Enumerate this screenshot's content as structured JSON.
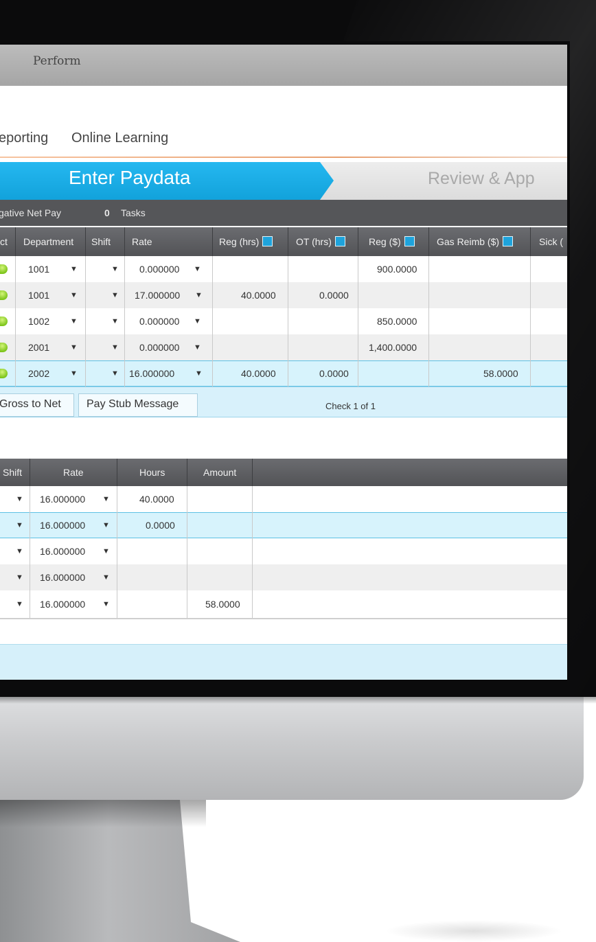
{
  "app": {
    "title": "Perform"
  },
  "menu": {
    "items": [
      "eporting",
      "Online Learning"
    ]
  },
  "steps": {
    "active": "Enter Paydata",
    "next": "Review & App"
  },
  "summary": {
    "label": "gative Net Pay",
    "task_count": "0",
    "task_label": "Tasks"
  },
  "top_grid": {
    "headers": {
      "select": "ct",
      "department": "Department",
      "shift": "Shift",
      "rate": "Rate",
      "reg_hrs": "Reg (hrs)",
      "ot_hrs": "OT (hrs)",
      "reg_dollars": "Reg ($)",
      "gas_reimb": "Gas Reimb ($)",
      "sick": "Sick ("
    },
    "rows": [
      {
        "department": "1001",
        "rate": "0.000000",
        "reg_hrs": "",
        "ot_hrs": "",
        "reg_dollars": "900.0000",
        "gas_reimb": ""
      },
      {
        "department": "1001",
        "rate": "17.000000",
        "reg_hrs": "40.0000",
        "ot_hrs": "0.0000",
        "reg_dollars": "",
        "gas_reimb": ""
      },
      {
        "department": "1002",
        "rate": "0.000000",
        "reg_hrs": "",
        "ot_hrs": "",
        "reg_dollars": "850.0000",
        "gas_reimb": ""
      },
      {
        "department": "2001",
        "rate": "0.000000",
        "reg_hrs": "",
        "ot_hrs": "",
        "reg_dollars": "1,400.0000",
        "gas_reimb": ""
      },
      {
        "department": "2002",
        "rate": "16.000000",
        "reg_hrs": "40.0000",
        "ot_hrs": "0.0000",
        "reg_dollars": "",
        "gas_reimb": "58.0000"
      }
    ]
  },
  "tabs": {
    "gross_to_net": "Gross to Net",
    "pay_stub_message": "Pay Stub Message",
    "check_status": "Check 1 of 1"
  },
  "bottom_grid": {
    "headers": {
      "shift": "Shift",
      "rate": "Rate",
      "hours": "Hours",
      "amount": "Amount"
    },
    "rows": [
      {
        "rate": "16.000000",
        "hours": "40.0000",
        "amount": ""
      },
      {
        "rate": "16.000000",
        "hours": "0.0000",
        "amount": ""
      },
      {
        "rate": "16.000000",
        "hours": "",
        "amount": ""
      },
      {
        "rate": "16.000000",
        "hours": "",
        "amount": ""
      },
      {
        "rate": "16.000000",
        "hours": "",
        "amount": "58.0000"
      }
    ]
  },
  "glyphs": {
    "dropdown": "▼"
  },
  "colors": {
    "accent_blue": "#12a2db",
    "selected_row": "#d7f3fc",
    "header_dark": "#525356",
    "status_green": "#7cc41a"
  }
}
